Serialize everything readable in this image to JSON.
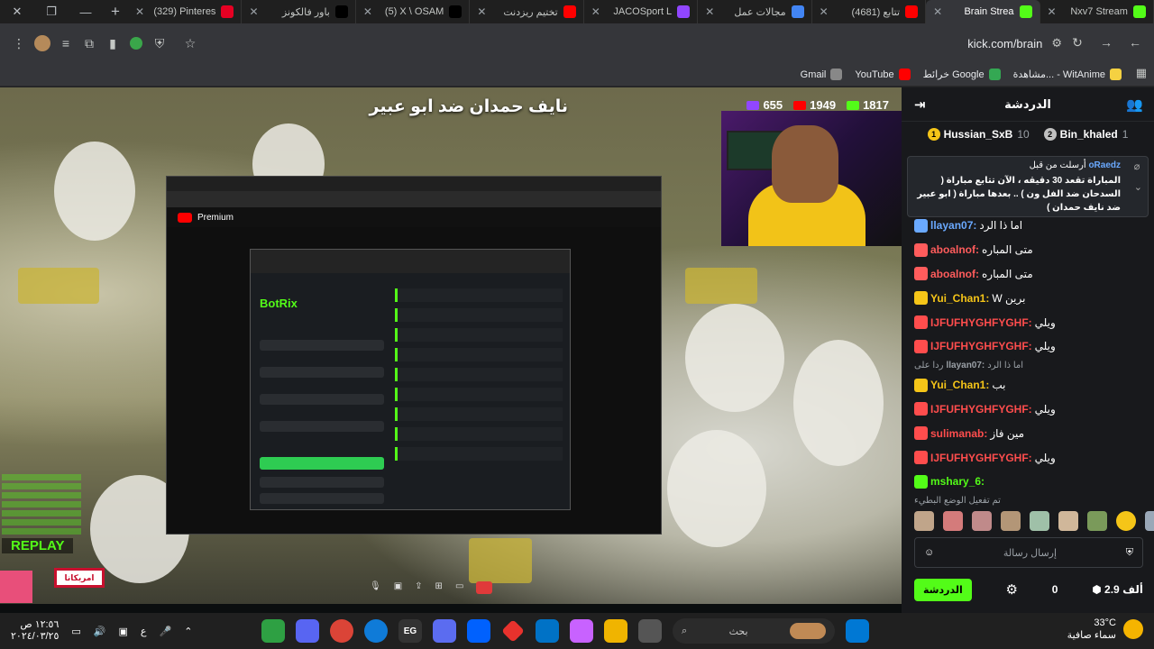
{
  "tabs": [
    {
      "label": "(329) Pinteres",
      "icon": "pinterest-icon",
      "color": "#e60023"
    },
    {
      "label": "باور فالكونز",
      "icon": "tiktok-icon",
      "color": "#000000"
    },
    {
      "label": "(5) X \\ OSAM",
      "icon": "x-icon",
      "color": "#000000"
    },
    {
      "label": "تختيم ريزدنت",
      "icon": "youtube-icon",
      "color": "#ff0000"
    },
    {
      "label": "JACOSport L",
      "icon": "twitch-icon",
      "color": "#9146ff"
    },
    {
      "label": "مجالات عمل",
      "icon": "gemini-icon",
      "color": "#4285f4"
    },
    {
      "label": "(4681) تتابع",
      "icon": "youtube-icon",
      "color": "#ff0000"
    },
    {
      "label": "Brain Strea",
      "icon": "kick-icon",
      "color": "#53fc18"
    },
    {
      "label": "Nxv7 Stream",
      "icon": "kick-icon",
      "color": "#53fc18"
    }
  ],
  "url": "kick.com/brain",
  "bookmarks": [
    {
      "label": "Gmail",
      "color": "#888888"
    },
    {
      "label": "YouTube",
      "color": "#ff0000"
    },
    {
      "label": "خرائط Google",
      "color": "#34a853"
    },
    {
      "label": "مشاهدة... - WitAnime",
      "color": "#f5d142"
    }
  ],
  "video": {
    "title": "نايف حمدان ضد ابو عبير",
    "stats": [
      {
        "value": "1817",
        "icon": "kick-icon",
        "color": "#53fc18"
      },
      {
        "value": "1949",
        "icon": "youtube-icon",
        "color": "#ff0000"
      },
      {
        "value": "655",
        "icon": "twitch-icon",
        "color": "#9146ff"
      }
    ],
    "overlay_label": "REPLAY",
    "inner_app": "BotRix",
    "sponsor_logo": "امريكانا"
  },
  "chat": {
    "title": "الدردشة",
    "leaders": [
      {
        "rank": "1",
        "name": "Hussian_SxB",
        "score": "10",
        "color": "#f5c518"
      },
      {
        "rank": "2",
        "name": "Bin_khaled",
        "score": "1",
        "color": "#c0c0c0"
      }
    ],
    "pinned": {
      "user": "oRaedz",
      "label": "أرسلت من قبل",
      "message": "المباراة تقعد 30 دقيقه ، الآن تتابع مباراة ( السدحان ضد الفل ون ) .. بعدها مباراة ( ابو عبير ضد نايف حمدان )"
    },
    "messages": [
      {
        "user": "llayan07:",
        "text": "اما ذا الرد",
        "color": "#6aa9ff"
      },
      {
        "user": "aboalnof:",
        "text": "متى المباره",
        "color": "#ff5c5c"
      },
      {
        "user": "aboalnof:",
        "text": "متى المباره",
        "color": "#ff5c5c"
      },
      {
        "user": "Yui_Chan1:",
        "text": "W برين",
        "color": "#f5c518"
      },
      {
        "user": "IJFUFHYGHFYGHF:",
        "text": "ويلي",
        "color": "#ff4d4d"
      },
      {
        "user": "IJFUFHYGHFYGHF:",
        "text": "ويلي",
        "color": "#ff4d4d"
      },
      {
        "user": "llayan07:",
        "text": "اما ذا الرد",
        "color": "#9aa0a6",
        "small": true,
        "prefix": "ردا على"
      },
      {
        "user": "Yui_Chan1:",
        "text": "بب",
        "color": "#f5c518"
      },
      {
        "user": "IJFUFHYGHFYGHF:",
        "text": "ويلي",
        "color": "#ff4d4d"
      },
      {
        "user": "sulimanab:",
        "text": "مين فاز",
        "color": "#ff4d4d"
      },
      {
        "user": "IJFUFHYGHFYGHF:",
        "text": "ويلي",
        "color": "#ff4d4d"
      },
      {
        "user": "mshary_6:",
        "text": "",
        "color": "#53fc18"
      }
    ],
    "mode_notice": "تم تفعيل الوضع البطيء",
    "input_placeholder": "إرسال رسالة",
    "viewers": "2.9 ألف",
    "points": "0",
    "send_label": "الدردشة"
  },
  "taskbar": {
    "time": "١٢:٥٦ ص",
    "date": "٢٠٢٤/٠٣/٢٥",
    "lang": "ع",
    "search_placeholder": "بحث",
    "temp": "33°C",
    "weather_desc": "سماء صافية"
  }
}
